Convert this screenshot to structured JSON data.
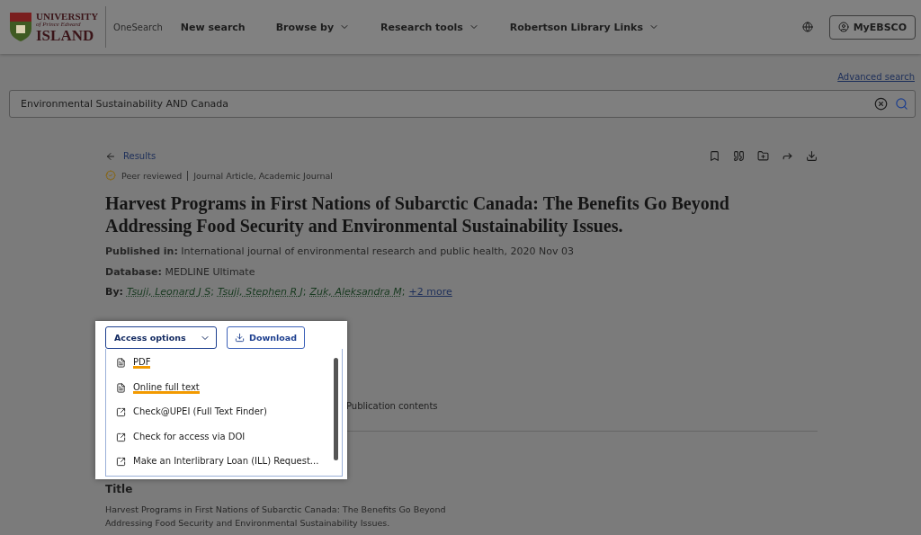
{
  "header": {
    "logo": {
      "line_1": "UNIVERSITY",
      "line_2": "of Prince Edward",
      "line_3": "ISLAND"
    },
    "product": "OneSearch",
    "nav": [
      {
        "label": "New search",
        "menu": false
      },
      {
        "label": "Browse by",
        "menu": true
      },
      {
        "label": "Research tools",
        "menu": true
      },
      {
        "label": "Robertson Library Links",
        "menu": true
      }
    ],
    "account_button": "MyEBSCO"
  },
  "search": {
    "advanced_link": "Advanced search",
    "value": "Environmental Sustainability AND Canada"
  },
  "record": {
    "back_link": "Results",
    "badge": "Peer reviewed",
    "types": "Journal Article, Academic Journal",
    "title": "Harvest Programs in First Nations of Subarctic Canada: The Benefits Go Beyond Addressing Food Security and Environmental Sustainability Issues.",
    "fields": [
      {
        "label": "Published in:",
        "value": "International journal of environmental research and public health, 2020 Nov 03"
      },
      {
        "label": "Database:",
        "value": "MEDLINE Ultimate"
      }
    ],
    "authors_label": "By:",
    "authors": [
      {
        "name": "Tsuji, Leonard J S",
        "separator": ";"
      },
      {
        "name": "Tsuji, Stephen R J",
        "separator": ";"
      },
      {
        "name": "Zuk, Aleksandra M",
        "separator": ";"
      }
    ],
    "more_authors": "+2 more",
    "access_button": "Access options",
    "download_button": "Download",
    "access_menu": [
      {
        "kind": "file",
        "label": "PDF",
        "highlighted": true
      },
      {
        "kind": "file",
        "label": "Online full text",
        "highlighted": true
      },
      {
        "kind": "external",
        "label": "Check@UPEI (Full Text Finder)",
        "highlighted": false
      },
      {
        "kind": "external",
        "label": "Check for access via DOI",
        "highlighted": false
      },
      {
        "kind": "external",
        "label": "Make an Interlibrary Loan (ILL) Request...",
        "highlighted": false
      }
    ],
    "tab": "Publication contents",
    "section_heading": "Title",
    "section_text": "Harvest Programs in First Nations of Subarctic Canada: The Benefits Go Beyond Addressing Food Security and Environmental Sustainability Issues."
  }
}
